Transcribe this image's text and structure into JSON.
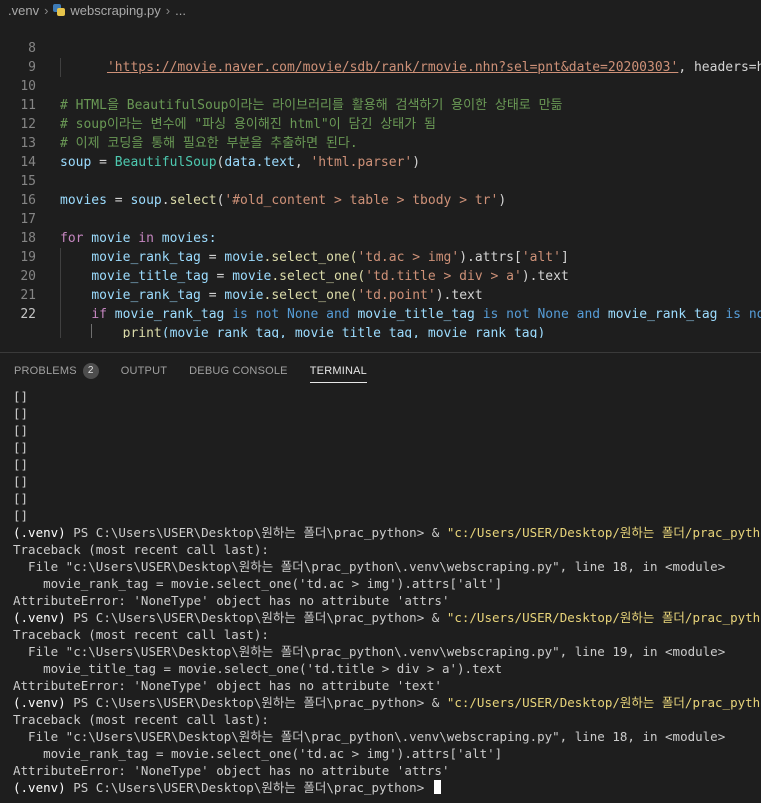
{
  "breadcrumb": {
    "folder": ".venv",
    "file": "webscraping.py",
    "more": "..."
  },
  "editor": {
    "lines": [
      {
        "num": "8"
      },
      {
        "num": "9"
      },
      {
        "num": "10"
      },
      {
        "num": "11"
      },
      {
        "num": "12"
      },
      {
        "num": "13"
      },
      {
        "num": "14"
      },
      {
        "num": "15"
      },
      {
        "num": "16"
      },
      {
        "num": "17"
      },
      {
        "num": "18"
      },
      {
        "num": "19"
      },
      {
        "num": "20"
      },
      {
        "num": "21"
      },
      {
        "num": "22"
      }
    ],
    "code": {
      "l8_url": "'https://movie.naver.com/movie/sdb/rank/rmovie.nhn?sel=pnt&date=20200303'",
      "l8_rest": ", headers=head",
      "l10": "# HTML을 BeautifulSoup이라는 라이브러리를 활용해 검색하기 용이한 상태로 만듦",
      "l11": "# soup이라는 변수에 \"파싱 용이해진 html\"이 담긴 상태가 됨",
      "l12": "# 이제 코딩을 통해 필요한 부분을 추출하면 된다.",
      "l13_var": "soup",
      "l13_eq": " = ",
      "l13_cls": "BeautifulSoup",
      "l13_open": "(",
      "l13_arg": "data.text",
      "l13_comma": ", ",
      "l13_str": "'html.parser'",
      "l13_close": ")",
      "l15_var": "movies",
      "l15_eq": " = ",
      "l15_obj": "soup",
      "l15_dot": ".",
      "l15_fn": "select",
      "l15_open": "(",
      "l15_str": "'#old_content > table > tbody > tr'",
      "l15_close": ")",
      "l17_for": "for",
      "l17_var": " movie ",
      "l17_in": "in",
      "l17_rest": " movies:",
      "l18_var": "movie_rank_tag",
      "l18_eq": " = ",
      "l18_obj": "movie",
      "l18_fn": ".select_one(",
      "l18_str": "'td.ac > img'",
      "l18_mid": ").attrs[",
      "l18_key": "'alt'",
      "l18_end": "]",
      "l19_var": "movie_title_tag",
      "l19_eq": " = ",
      "l19_obj": "movie",
      "l19_fn": ".select_one(",
      "l19_str": "'td.title > div > a'",
      "l19_end": ").text",
      "l20_var": "movie_rank_tag",
      "l20_eq": " = ",
      "l20_obj": "movie",
      "l20_fn": ".select_one(",
      "l20_str": "'td.point'",
      "l20_end": ").text",
      "l21_if": "if",
      "l21_a": " movie_rank_tag ",
      "l21_is1": "is not",
      "l21_none1": " None ",
      "l21_and1": "and",
      "l21_b": " movie_title_tag ",
      "l21_is2": "is not",
      "l21_none2": " None ",
      "l21_and2": "and",
      "l21_c": " movie_rank_tag ",
      "l21_is3": "is not",
      "l22_fn": "print",
      "l22_args": "(movie_rank_tag, movie_title_tag, movie_rank_tag)"
    }
  },
  "panel": {
    "tabs": [
      {
        "label": "PROBLEMS",
        "badge": "2"
      },
      {
        "label": "OUTPUT"
      },
      {
        "label": "DEBUG CONSOLE"
      },
      {
        "label": "TERMINAL"
      }
    ]
  },
  "terminal": {
    "empty_lists": [
      "[]",
      "[]",
      "[]",
      "[]",
      "[]",
      "[]",
      "[]",
      "[]"
    ],
    "prompt_env": "(.venv)",
    "prompt_ps": " PS C:\\Users\\USER\\Desktop\\원하는 폴더\\prac_python> ",
    "prompt_amp": "& ",
    "prompt_path": "\"c:/Users/USER/Desktop/원하는 폴더/prac_python/",
    "blocks": [
      {
        "traceback": "Traceback (most recent call last):",
        "file": "  File \"c:\\Users\\USER\\Desktop\\원하는 폴더\\prac_python\\.venv\\webscraping.py\", line 18, in <module>",
        "code": "    movie_rank_tag = movie.select_one('td.ac > img').attrs['alt']",
        "error": "AttributeError: 'NoneType' object has no attribute 'attrs'"
      },
      {
        "traceback": "Traceback (most recent call last):",
        "file": "  File \"c:\\Users\\USER\\Desktop\\원하는 폴더\\prac_python\\.venv\\webscraping.py\", line 19, in <module>",
        "code": "    movie_title_tag = movie.select_one('td.title > div > a').text",
        "error": "AttributeError: 'NoneType' object has no attribute 'text'"
      },
      {
        "traceback": "Traceback (most recent call last):",
        "file": "  File \"c:\\Users\\USER\\Desktop\\원하는 폴더\\prac_python\\.venv\\webscraping.py\", line 18, in <module>",
        "code": "    movie_rank_tag = movie.select_one('td.ac > img').attrs['alt']",
        "error": "AttributeError: 'NoneType' object has no attribute 'attrs'"
      }
    ]
  },
  "colors": {
    "background": "#1e1e1e",
    "keyword": "#569cd6",
    "control": "#c586c0",
    "string": "#ce9178",
    "function": "#dcdcaa",
    "variable": "#9cdcfe",
    "comment": "#6a9955",
    "class": "#4ec9b0",
    "prompt_path": "#e8d47a"
  }
}
